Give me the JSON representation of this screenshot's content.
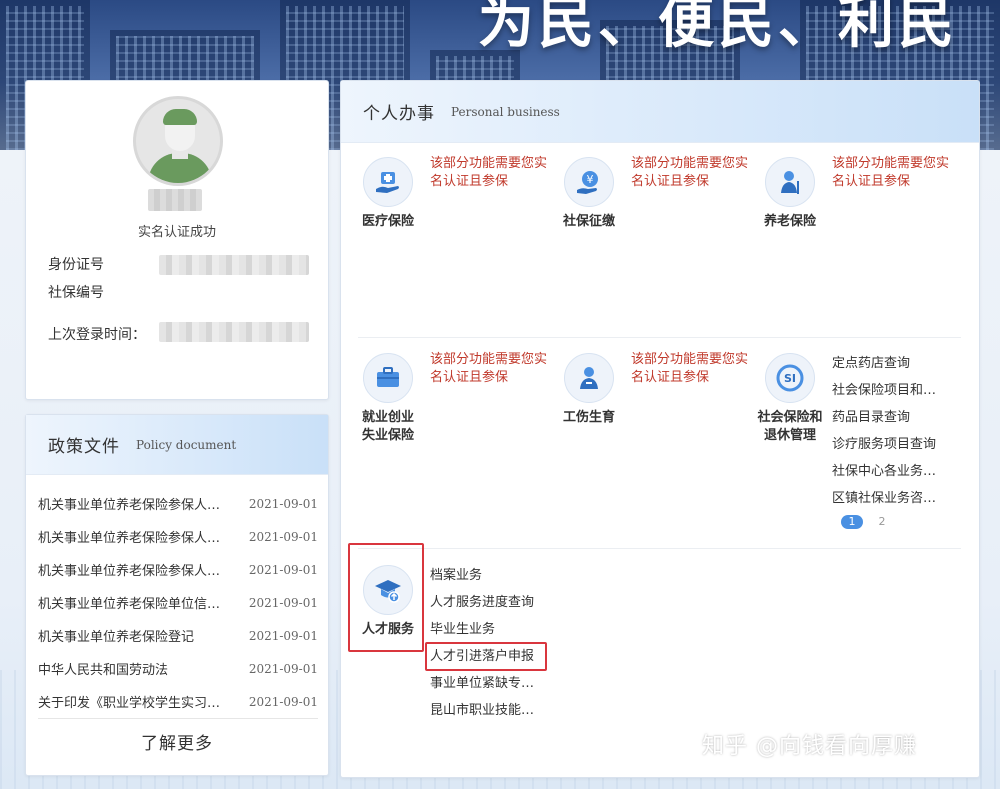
{
  "hero": {
    "slogan": "为民、便民、利民"
  },
  "user": {
    "verify_status": "实名认证成功",
    "id_label": "身份证号",
    "ss_label": "社保编号",
    "last_login_label": "上次登录时间："
  },
  "policy": {
    "title_zh": "政策文件",
    "title_en": "Policy document",
    "items": [
      {
        "title": "机关事业单位养老保险参保人…",
        "date": "2021-09-01"
      },
      {
        "title": "机关事业单位养老保险参保人…",
        "date": "2021-09-01"
      },
      {
        "title": "机关事业单位养老保险参保人…",
        "date": "2021-09-01"
      },
      {
        "title": "机关事业单位养老保险单位信…",
        "date": "2021-09-01"
      },
      {
        "title": "机关事业单位养老保险登记",
        "date": "2021-09-01"
      },
      {
        "title": "中华人民共和国劳动法",
        "date": "2021-09-01"
      },
      {
        "title": "关于印发《职业学校学生实习…",
        "date": "2021-09-01"
      }
    ],
    "more": "了解更多"
  },
  "business": {
    "title_zh": "个人办事",
    "title_en": "Personal business",
    "notice": "该部分功能需要您实名认证且参保",
    "services": [
      {
        "name": "医疗保险",
        "icon": "medical-icon"
      },
      {
        "name": "社保征缴",
        "icon": "yuan-hand-icon"
      },
      {
        "name": "养老保险",
        "icon": "elder-icon"
      },
      {
        "name": "就业创业失业保险",
        "icon": "briefcase-icon"
      },
      {
        "name": "工伤生育",
        "icon": "injury-icon"
      },
      {
        "name": "社会保险和退休管理",
        "icon": "social-insurance-logo-icon"
      },
      {
        "name": "人才服务",
        "icon": "graduation-cap-icon"
      }
    ],
    "social_links": [
      "定点药店查询",
      "社会保险项目和…",
      "药品目录查询",
      "诊疗服务项目查询",
      "社保中心各业务…",
      "区镇社保业务咨…"
    ],
    "pages": [
      "1",
      "2"
    ],
    "talent_links": [
      "档案业务",
      "人才服务进度查询",
      "毕业生业务",
      "人才引进落户申报",
      "事业单位紧缺专…",
      "昆山市职业技能…"
    ]
  },
  "watermark": "知乎 @向钱看向厚赚",
  "colors": {
    "notice_red": "#c0392b",
    "highlight_red": "#d9363e",
    "accent_blue": "#4a90e2"
  }
}
